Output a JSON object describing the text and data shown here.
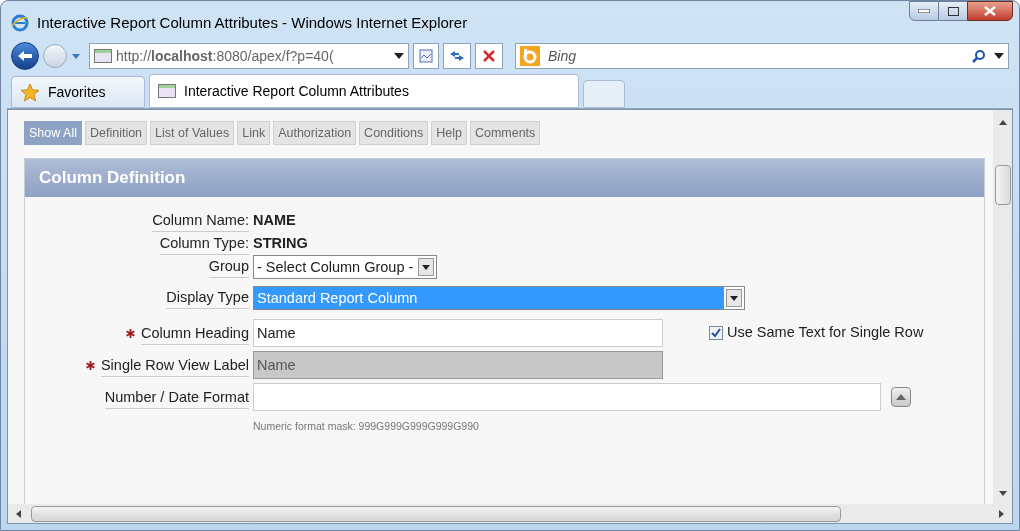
{
  "window": {
    "title": "Interactive Report Column Attributes - Windows Internet Explorer"
  },
  "address_bar": {
    "url": "http://**localhost**:8080/apex/f?p=40("
  },
  "search": {
    "placeholder": "Bing"
  },
  "favorites": {
    "label": "Favorites"
  },
  "tabs": [
    {
      "label": "Interactive Report Column Attributes",
      "selected": true
    }
  ],
  "page_buttons": [
    {
      "label": "Show All",
      "selected": true
    },
    {
      "label": "Definition",
      "selected": false
    },
    {
      "label": "List of Values",
      "selected": false
    },
    {
      "label": "Link",
      "selected": false
    },
    {
      "label": "Authorization",
      "selected": false
    },
    {
      "label": "Conditions",
      "selected": false
    },
    {
      "label": "Help",
      "selected": false
    },
    {
      "label": "Comments",
      "selected": false
    }
  ],
  "section": {
    "title": "Column Definition"
  },
  "fields": [
    {
      "kind": "static",
      "label": "Column Name:",
      "value": "NAME"
    },
    {
      "kind": "static",
      "label": "Column Type:",
      "value": "STRING"
    },
    {
      "kind": "select",
      "label": "Group",
      "value": "- Select Column Group -",
      "focused": false
    },
    {
      "kind": "select",
      "label": "Display Type",
      "value": "Standard Report Column",
      "focused": true
    },
    {
      "kind": "text",
      "label": "Column Heading",
      "required": true,
      "disabled": false,
      "value": "Name",
      "checkbox": {
        "label": "Use Same Text for Single Row",
        "checked": true
      }
    },
    {
      "kind": "text",
      "label": "Single Row View Label",
      "required": true,
      "disabled": true,
      "value": "Name"
    },
    {
      "kind": "text",
      "label": "Number / Date Format",
      "required": false,
      "disabled": false,
      "popup": true,
      "hint": "Numeric format mask: 999G999G999G999G990"
    }
  ]
}
